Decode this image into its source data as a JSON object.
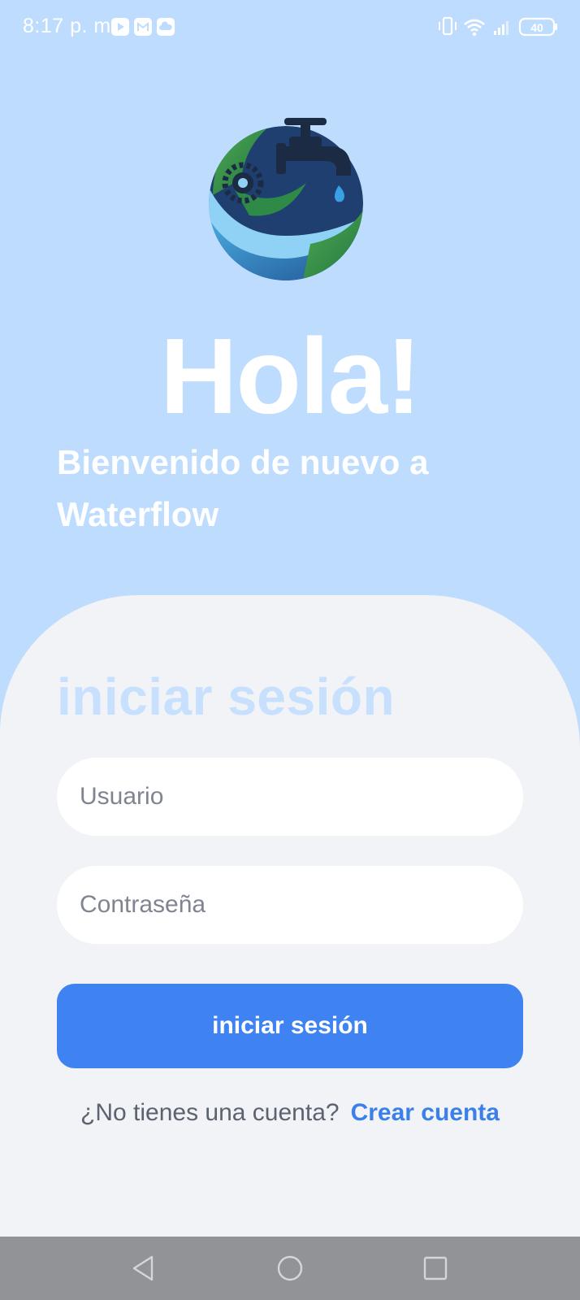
{
  "status_bar": {
    "time": "8:17 p. m.",
    "notification_icons": [
      "youtube-icon",
      "mail-icon",
      "cloud-icon"
    ],
    "system_icons": [
      "vibrate-icon",
      "wifi-icon",
      "signal-icon",
      "battery-icon"
    ],
    "battery_level": "40"
  },
  "header": {
    "greeting": "Hola!",
    "welcome_line_1": "Bienvenido de nuevo a",
    "welcome_line_2": "Waterflow"
  },
  "login": {
    "title": "iniciar sesión",
    "username_placeholder": "Usuario",
    "password_placeholder": "Contraseña",
    "submit_label": "iniciar sesión",
    "signup_prompt": "¿No tienes una cuenta?",
    "signup_link": "Crear cuenta"
  },
  "nav_bar": {
    "buttons": [
      "back-icon",
      "home-icon",
      "recents-icon"
    ]
  },
  "colors": {
    "background": "#bedcfd",
    "card": "#f1f3f6",
    "primary": "#3f82f1",
    "link": "#3b80ea",
    "title_faded": "#c6e0fd"
  }
}
